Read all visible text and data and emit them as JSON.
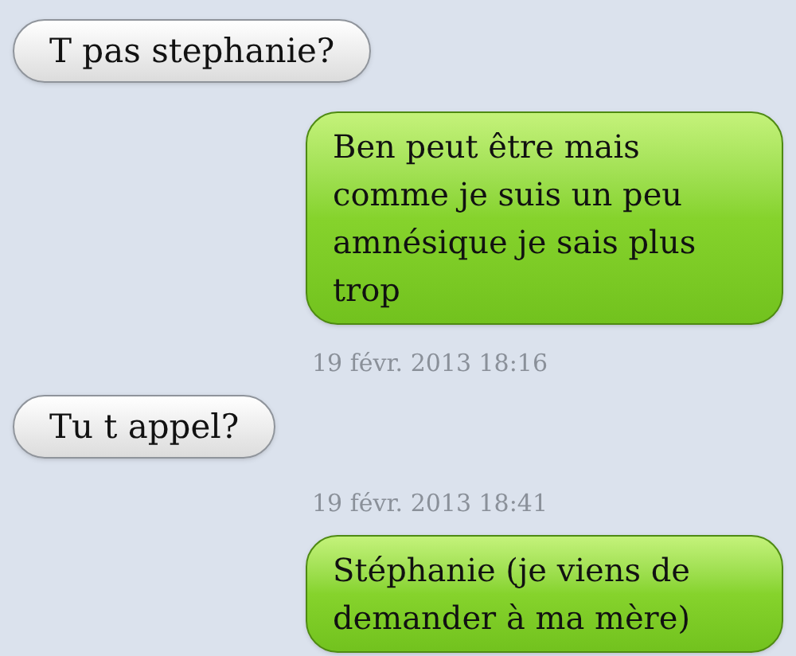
{
  "messages": [
    {
      "kind": "received",
      "lines": [
        "T pas stephanie?"
      ]
    },
    {
      "kind": "sent",
      "lines": [
        "Ben peut être mais",
        "comme je suis un peu",
        "amnésique je sais plus",
        "trop"
      ]
    },
    {
      "kind": "timestamp",
      "text": "19 févr. 2013 18:16"
    },
    {
      "kind": "received",
      "lines": [
        "Tu t appel?"
      ]
    },
    {
      "kind": "timestamp",
      "text": "19 févr. 2013 18:41"
    },
    {
      "kind": "sent",
      "lines": [
        "Stéphanie (je viens de",
        "demander à ma mère)"
      ]
    }
  ]
}
